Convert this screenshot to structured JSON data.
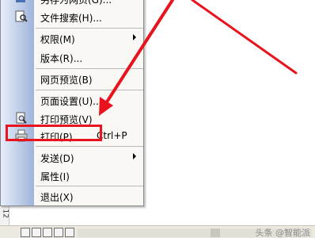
{
  "menu": {
    "items": [
      {
        "label": "另存为网页(G)...",
        "shortcut": "",
        "submenu": false,
        "icon": "save-as-webpage-icon"
      },
      {
        "label": "文件搜索(H)...",
        "shortcut": "",
        "submenu": false,
        "icon": "file-search-icon"
      },
      {
        "label": "权限(M)",
        "shortcut": "",
        "submenu": true,
        "icon": ""
      },
      {
        "label": "版本(R)...",
        "shortcut": "",
        "submenu": false,
        "icon": ""
      },
      {
        "label": "网页预览(B)",
        "shortcut": "",
        "submenu": false,
        "icon": ""
      },
      {
        "label": "页面设置(U)...",
        "shortcut": "",
        "submenu": false,
        "icon": ""
      },
      {
        "label": "打印预览(V)",
        "shortcut": "",
        "submenu": false,
        "icon": "print-preview-icon"
      },
      {
        "label": "打印(P)...",
        "shortcut": "Ctrl+P",
        "submenu": false,
        "icon": "print-icon"
      },
      {
        "label": "发送(D)",
        "shortcut": "",
        "submenu": true,
        "icon": ""
      },
      {
        "label": "属性(I)",
        "shortcut": "",
        "submenu": false,
        "icon": ""
      },
      {
        "label": "退出(X)",
        "shortcut": "",
        "submenu": false,
        "icon": ""
      }
    ]
  },
  "ruler": {
    "number": "12"
  },
  "watermark": "头条 @智能派",
  "colors": {
    "highlight": "#e8131c",
    "menu_bg": "#f9f8f4",
    "menu_side": "#bccbe6"
  }
}
